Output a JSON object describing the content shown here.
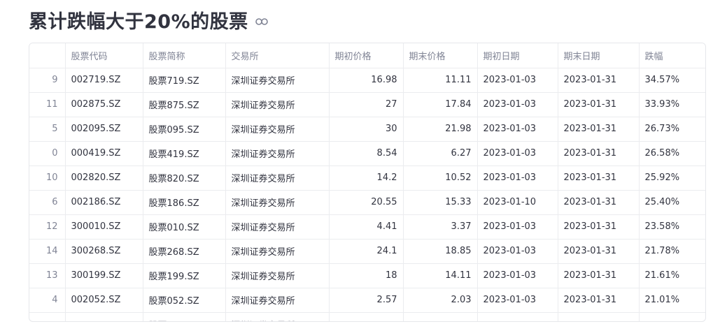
{
  "page": {
    "title": "累计跌幅大于20%的股票"
  },
  "table": {
    "columns": [
      "",
      "股票代码",
      "股票简称",
      "交易所",
      "期初价格",
      "期末价格",
      "期初日期",
      "期末日期",
      "跌幅"
    ],
    "rows": [
      [
        "9",
        "002719.SZ",
        "股票719.SZ",
        "深圳证券交易所",
        "16.98",
        "11.11",
        "2023-01-03",
        "2023-01-31",
        "34.57%"
      ],
      [
        "11",
        "002875.SZ",
        "股票875.SZ",
        "深圳证券交易所",
        "27",
        "17.84",
        "2023-01-03",
        "2023-01-31",
        "33.93%"
      ],
      [
        "5",
        "002095.SZ",
        "股票095.SZ",
        "深圳证券交易所",
        "30",
        "21.98",
        "2023-01-03",
        "2023-01-31",
        "26.73%"
      ],
      [
        "0",
        "000419.SZ",
        "股票419.SZ",
        "深圳证券交易所",
        "8.54",
        "6.27",
        "2023-01-03",
        "2023-01-31",
        "26.58%"
      ],
      [
        "10",
        "002820.SZ",
        "股票820.SZ",
        "深圳证券交易所",
        "14.2",
        "10.52",
        "2023-01-03",
        "2023-01-31",
        "25.92%"
      ],
      [
        "6",
        "002186.SZ",
        "股票186.SZ",
        "深圳证券交易所",
        "20.55",
        "15.33",
        "2023-01-10",
        "2023-01-31",
        "25.40%"
      ],
      [
        "12",
        "300010.SZ",
        "股票010.SZ",
        "深圳证券交易所",
        "4.41",
        "3.37",
        "2023-01-03",
        "2023-01-31",
        "23.58%"
      ],
      [
        "14",
        "300268.SZ",
        "股票268.SZ",
        "深圳证券交易所",
        "24.1",
        "18.85",
        "2023-01-03",
        "2023-01-31",
        "21.78%"
      ],
      [
        "13",
        "300199.SZ",
        "股票199.SZ",
        "深圳证券交易所",
        "18",
        "14.11",
        "2023-01-03",
        "2023-01-31",
        "21.61%"
      ],
      [
        "4",
        "002052.SZ",
        "股票052.SZ",
        "深圳证券交易所",
        "2.57",
        "2.03",
        "2023-01-03",
        "2023-01-31",
        "21.01%"
      ],
      [
        "",
        "",
        "股票",
        "深圳证券交易所",
        "",
        "",
        "",
        "",
        ""
      ]
    ]
  },
  "icons": {
    "title_link": "link-icon"
  },
  "colors": {
    "text": "#31333f",
    "muted": "#808495",
    "border": "#e6e7eb"
  }
}
